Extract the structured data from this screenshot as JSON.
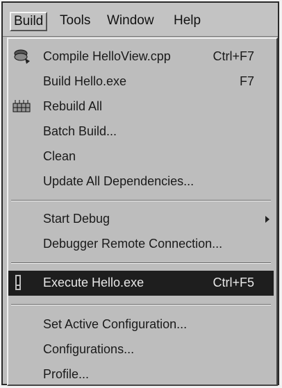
{
  "menubar": {
    "items": [
      {
        "label": "Build"
      },
      {
        "label": "Tools"
      },
      {
        "label": "Window"
      },
      {
        "label": "Help"
      }
    ]
  },
  "menu": {
    "items": [
      {
        "label": "Compile HelloView.cpp",
        "shortcut": "Ctrl+F7",
        "icon": "compile-icon"
      },
      {
        "label": "Build Hello.exe",
        "shortcut": "F7"
      },
      {
        "label": "Rebuild All",
        "icon": "rebuild-icon"
      },
      {
        "label": "Batch Build..."
      },
      {
        "label": "Clean"
      },
      {
        "label": "Update All Dependencies..."
      },
      {
        "label": "Start Debug",
        "submenu": true
      },
      {
        "label": "Debugger Remote Connection..."
      },
      {
        "label": "Execute Hello.exe",
        "shortcut": "Ctrl+F5",
        "icon": "execute-icon",
        "highlighted": true
      },
      {
        "label": "Set Active Configuration..."
      },
      {
        "label": "Configurations..."
      },
      {
        "label": "Profile..."
      }
    ]
  }
}
